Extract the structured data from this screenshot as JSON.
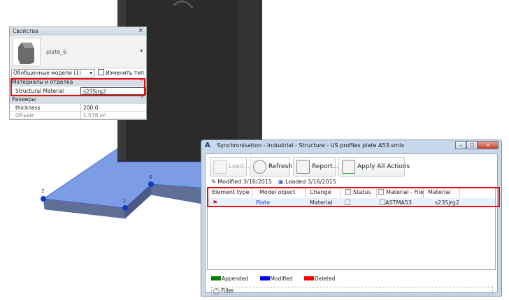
{
  "viewport": {
    "point_labels": [
      "2",
      "1",
      "6"
    ],
    "plate_color": "#5b7fd9",
    "column_color": "#2b2b2b"
  },
  "properties": {
    "title": "Свойства",
    "close_icon": "close-icon",
    "element_name": "plate_6",
    "type_selector": "Обобщенные модели (1)",
    "edit_type_label": "Изменить тип",
    "sections": [
      {
        "name": "Материалы и отделка",
        "rows": [
          {
            "label": "Structural Material",
            "value": "s235jrg2"
          }
        ]
      },
      {
        "name": "Размеры",
        "rows": [
          {
            "label": "thickness",
            "value": "200.0"
          },
          {
            "label": "Объем",
            "value": "1.076 м³"
          }
        ]
      }
    ]
  },
  "sync": {
    "title": "Synchronisation - Industrial - Structure - US profiles plate A53.smlx",
    "toolbar": {
      "load": "Load...",
      "refresh": "Refresh",
      "report": "Report...",
      "apply": "Apply All Actions"
    },
    "modified": "Modified 3/16/2015",
    "loaded": "Loaded 3/16/2015",
    "columns": [
      "Element type",
      "Model object",
      "Change",
      "Status",
      "Material - File",
      "Material"
    ],
    "rows": [
      {
        "element_type_icon": "red-flag-icon",
        "model_object": "Plate",
        "change": "Material",
        "status": false,
        "material_file": "ASTMA53",
        "material": "s235jrg2"
      }
    ],
    "legend": [
      {
        "label": "Appended",
        "color": "#008000"
      },
      {
        "label": "Modified",
        "color": "#0000ff"
      },
      {
        "label": "Deleted",
        "color": "#ff0000"
      }
    ],
    "filter_label": "Filter",
    "highlight_color": "#e01010"
  }
}
